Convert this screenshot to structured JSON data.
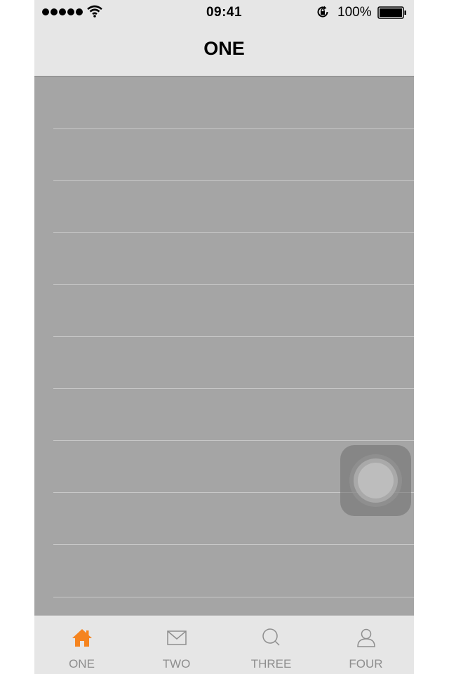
{
  "status_bar": {
    "time": "09:41",
    "battery_percent": "100%",
    "signal_bars": 5,
    "icons": [
      "signal-dots-icon",
      "wifi-icon",
      "rotation-lock-icon",
      "battery-icon"
    ]
  },
  "nav": {
    "title": "ONE"
  },
  "list": {
    "row_count": 10
  },
  "assistive_touch": {
    "icon": "assistive-touch-icon"
  },
  "tab_bar": {
    "tabs": [
      {
        "label": "ONE",
        "icon": "home-icon",
        "active": true
      },
      {
        "label": "TWO",
        "icon": "mail-icon",
        "active": false
      },
      {
        "label": "THREE",
        "icon": "search-icon",
        "active": false
      },
      {
        "label": "FOUR",
        "icon": "user-icon",
        "active": false
      }
    ]
  },
  "colors": {
    "accent": "#f5841f",
    "inactive": "#8e8e8e",
    "bar_background": "#e6e6e6",
    "content_background": "#a5a5a5"
  }
}
